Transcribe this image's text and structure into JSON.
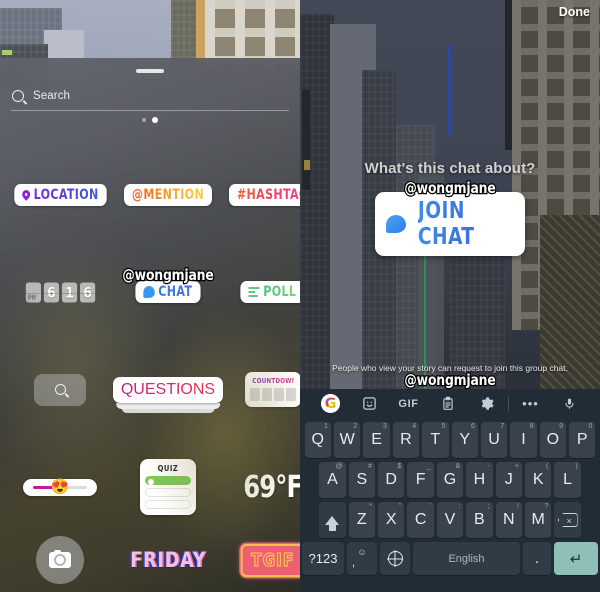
{
  "left_screen": {
    "name": "instagram-story-sticker-tray",
    "search": {
      "placeholder": "Search",
      "icon": "search-icon"
    },
    "page_dots": {
      "total": 2,
      "active_index": 1
    },
    "stickers": [
      {
        "id": "location",
        "label": "LOCATION",
        "icon": "map-pin-icon"
      },
      {
        "id": "mention",
        "label": "@MENTION",
        "icon": ""
      },
      {
        "id": "hashtag",
        "label": "#HASHTAG",
        "icon": ""
      },
      {
        "id": "time",
        "label": "6 16",
        "icon": "flip-clock-icon"
      },
      {
        "id": "chat",
        "label": "CHAT",
        "icon": "chat-bubble-icon",
        "username": "@wongmjane"
      },
      {
        "id": "poll",
        "label": "POLL",
        "icon": "poll-bars-icon"
      },
      {
        "id": "search-placeholder",
        "label": "",
        "icon": "search-icon"
      },
      {
        "id": "questions",
        "label": "QUESTIONS",
        "icon": ""
      },
      {
        "id": "countdown",
        "label": "COUNTDOWN",
        "icon": ""
      },
      {
        "id": "emoji-slider",
        "label": "",
        "icon": "heart-eyes-emoji",
        "emoji": "😍"
      },
      {
        "id": "quiz",
        "label": "QUIZ",
        "icon": ""
      },
      {
        "id": "temperature",
        "label": "69°F",
        "icon": ""
      },
      {
        "id": "camera",
        "label": "",
        "icon": "camera-icon"
      },
      {
        "id": "friday",
        "label": "FRIDAY",
        "icon": ""
      },
      {
        "id": "tgif",
        "label": "TGIF",
        "icon": ""
      }
    ]
  },
  "right_screen": {
    "name": "join-chat-sticker-editor",
    "done_label": "Done",
    "prompt": "What's this chat about?",
    "sticker": {
      "username": "@wongmjane",
      "label": "JOIN CHAT",
      "icon": "chat-bubble-icon"
    },
    "hint": "People who view your story can request to join this group chat.",
    "hint_username": "@wongmjane",
    "keyboard": {
      "name": "gboard",
      "toolbar": [
        {
          "id": "google",
          "icon": "google-logo-icon",
          "label": "G"
        },
        {
          "id": "stickers",
          "icon": "sticker-face-icon",
          "label": ""
        },
        {
          "id": "gif",
          "icon": "gif-icon",
          "label": "GIF"
        },
        {
          "id": "clipboard",
          "icon": "clipboard-icon",
          "label": ""
        },
        {
          "id": "settings",
          "icon": "gear-icon",
          "label": ""
        },
        {
          "id": "divider",
          "icon": "divider",
          "label": ""
        },
        {
          "id": "more",
          "icon": "ellipsis-icon",
          "label": "•••"
        },
        {
          "id": "voice",
          "icon": "microphone-icon",
          "label": ""
        }
      ],
      "row1": [
        {
          "k": "Q",
          "s": "1"
        },
        {
          "k": "W",
          "s": "2"
        },
        {
          "k": "E",
          "s": "3"
        },
        {
          "k": "R",
          "s": "4"
        },
        {
          "k": "T",
          "s": "5"
        },
        {
          "k": "Y",
          "s": "6"
        },
        {
          "k": "U",
          "s": "7"
        },
        {
          "k": "I",
          "s": "8"
        },
        {
          "k": "O",
          "s": "9"
        },
        {
          "k": "P",
          "s": "0"
        }
      ],
      "row2": [
        {
          "k": "A",
          "s": "@"
        },
        {
          "k": "S",
          "s": "#"
        },
        {
          "k": "D",
          "s": "$"
        },
        {
          "k": "F",
          "s": "_"
        },
        {
          "k": "G",
          "s": "&"
        },
        {
          "k": "H",
          "s": "-"
        },
        {
          "k": "J",
          "s": "+"
        },
        {
          "k": "K",
          "s": "("
        },
        {
          "k": "L",
          "s": ")"
        }
      ],
      "row3": [
        {
          "k": "Z",
          "s": "*"
        },
        {
          "k": "X",
          "s": "\""
        },
        {
          "k": "C",
          "s": "'"
        },
        {
          "k": "V",
          "s": ":"
        },
        {
          "k": "B",
          "s": ";"
        },
        {
          "k": "N",
          "s": "!"
        },
        {
          "k": "M",
          "s": "?"
        }
      ],
      "shift_icon": "shift-icon",
      "backspace_icon": "backspace-icon",
      "symbols_label": "?123",
      "emoji_key": {
        "top": "☺",
        "bottom": ","
      },
      "globe_icon": "globe-icon",
      "space_label": "English",
      "period_label": ".",
      "enter_icon": "enter-icon",
      "enter_color": "#8fc0b8"
    }
  }
}
